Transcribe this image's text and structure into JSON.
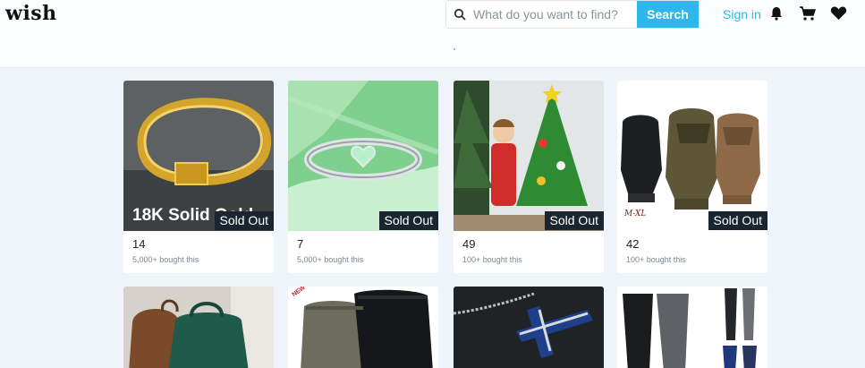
{
  "header": {
    "logo": "wish",
    "search": {
      "placeholder": "What do you want to find?",
      "button_label": "Search"
    },
    "signin_label": "Sign in"
  },
  "colors": {
    "accent": "#2fb7ec",
    "sold_badge": "#1b2530",
    "background": "#eef4f9"
  },
  "products": [
    {
      "price": "14",
      "bought": "5,000+ bought this",
      "badge": "Sold Out",
      "overlay_text": "18K Solid Gold",
      "icon": "gold-chain-bracelet"
    },
    {
      "price": "7",
      "bought": "5,000+ bought this",
      "badge": "Sold Out",
      "icon": "silver-heart-ring"
    },
    {
      "price": "49",
      "bought": "100+ bought this",
      "badge": "Sold Out",
      "icon": "felt-christmas-tree"
    },
    {
      "price": "42",
      "bought": "100+ bought this",
      "badge": "Sold Out",
      "size_label": "M-XL",
      "icon": "tactical-gloves"
    }
  ],
  "products_row2": [
    {
      "icon": "handbags"
    },
    {
      "icon": "kappa-joggers",
      "badge": "NEW"
    },
    {
      "icon": "cross-necklace"
    },
    {
      "icon": "leggings"
    }
  ]
}
